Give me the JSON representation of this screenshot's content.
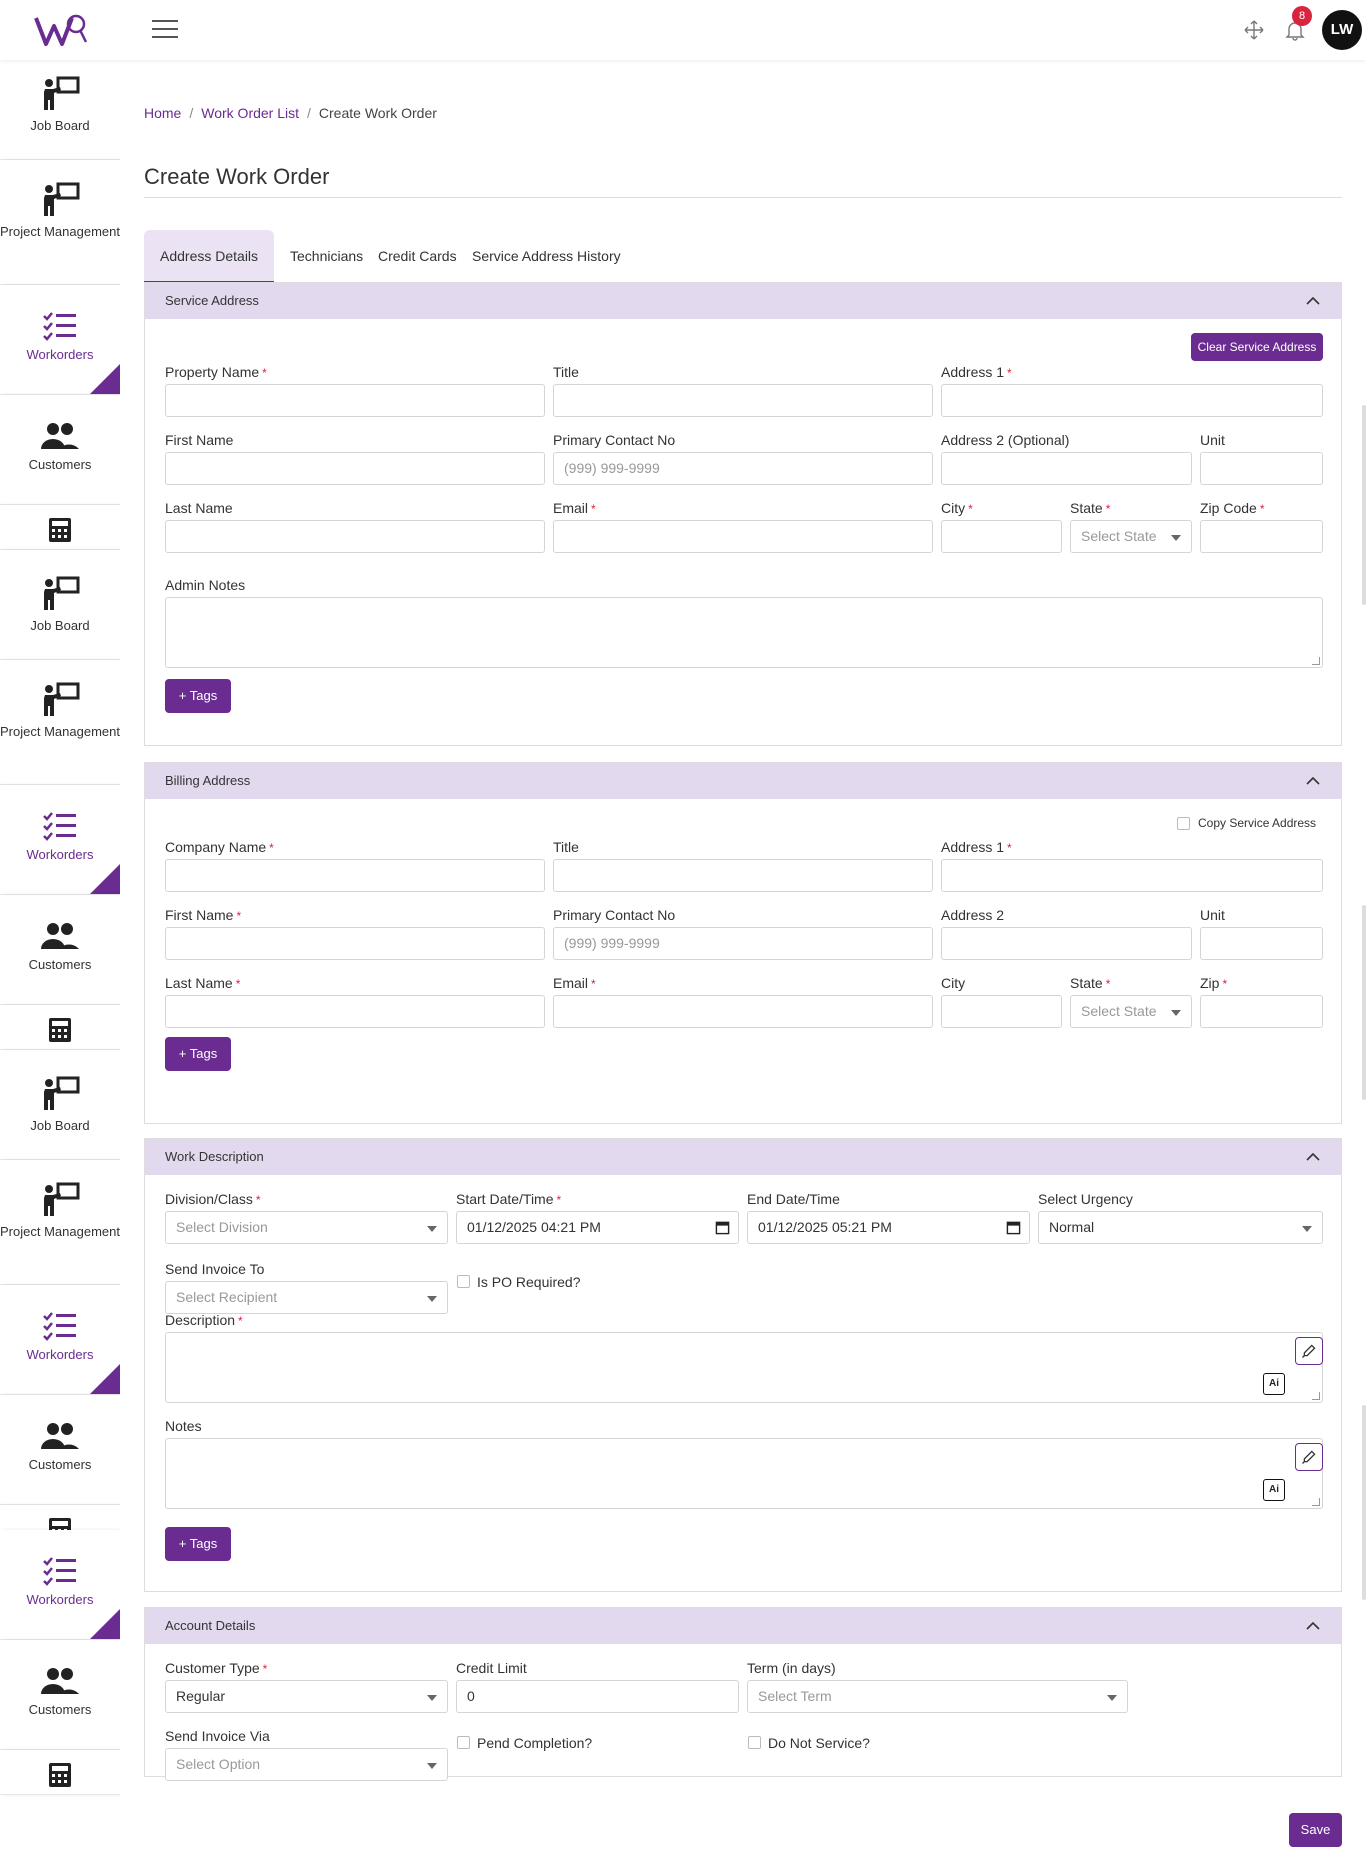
{
  "app": {
    "brand_colors": {
      "accent": "#6a2c91",
      "panel": "#e3d9ee",
      "required": "#d9233f"
    }
  },
  "topbar": {
    "notification_count": "8",
    "avatar_initials": "LW",
    "icons": [
      "menu-icon",
      "move-icon",
      "bell-icon"
    ]
  },
  "sidebar": {
    "items": [
      {
        "label": "Job Board",
        "icon": "presenter-board-icon"
      },
      {
        "label": "Project Management",
        "icon": "presenter-board-icon"
      },
      {
        "label": "Workorders",
        "icon": "checklist-icon",
        "active": true
      },
      {
        "label": "Customers",
        "icon": "users-icon"
      },
      {
        "label": "",
        "icon": "calculator-icon"
      }
    ]
  },
  "breadcrumb": {
    "home": "Home",
    "list": "Work Order List",
    "current": "Create Work Order",
    "separator": "/"
  },
  "page": {
    "title": "Create Work Order"
  },
  "tabs": [
    "Address Details",
    "Technicians",
    "Credit Cards",
    "Service Address History"
  ],
  "service_address": {
    "heading": "Service Address",
    "clear_button": "Clear Service Address",
    "property_name": "Property Name",
    "title": "Title",
    "address1": "Address 1",
    "first_name": "First Name",
    "primary_contact": "Primary Contact No",
    "phone_placeholder": "(999) 999-9999",
    "address2": "Address 2 (Optional)",
    "unit": "Unit",
    "last_name": "Last Name",
    "email": "Email",
    "city": "City",
    "state": "State",
    "state_placeholder": "Select State",
    "zip": "Zip Code",
    "admin_notes": "Admin Notes",
    "tags_button": "Tags"
  },
  "billing_address": {
    "heading": "Billing Address",
    "copy_label": "Copy Service Address",
    "company_name": "Company Name",
    "title": "Title",
    "address1": "Address 1",
    "first_name": "First Name",
    "primary_contact": "Primary Contact No",
    "phone_placeholder": "(999) 999-9999",
    "address2": "Address 2",
    "unit": "Unit",
    "last_name": "Last Name",
    "email": "Email",
    "city": "City",
    "state": "State",
    "state_placeholder": "Select State",
    "zip": "Zip",
    "tags_button": "Tags"
  },
  "work_description": {
    "heading": "Work Description",
    "division": "Division/Class",
    "division_placeholder": "Select Division",
    "start": "Start Date/Time",
    "start_value": "01/12/2025 04:21 PM",
    "end": "End Date/Time",
    "end_value": "01/12/2025 05:21 PM",
    "urgency": "Select Urgency",
    "urgency_value": "Normal",
    "send_invoice_to": "Send Invoice To",
    "recipient_placeholder": "Select Recipient",
    "po_required": "Is PO Required?",
    "description": "Description",
    "notes": "Notes",
    "ai_label": "Ai",
    "tags_button": "Tags"
  },
  "account_details": {
    "heading": "Account Details",
    "customer_type": "Customer Type",
    "customer_type_value": "Regular",
    "credit_limit": "Credit Limit",
    "credit_limit_value": "0",
    "term": "Term (in days)",
    "term_placeholder": "Select Term",
    "send_invoice_via": "Send Invoice Via",
    "invoice_via_placeholder": "Select Option",
    "pend_completion": "Pend Completion?",
    "do_not_service": "Do Not Service?"
  },
  "actions": {
    "save": "Save"
  }
}
